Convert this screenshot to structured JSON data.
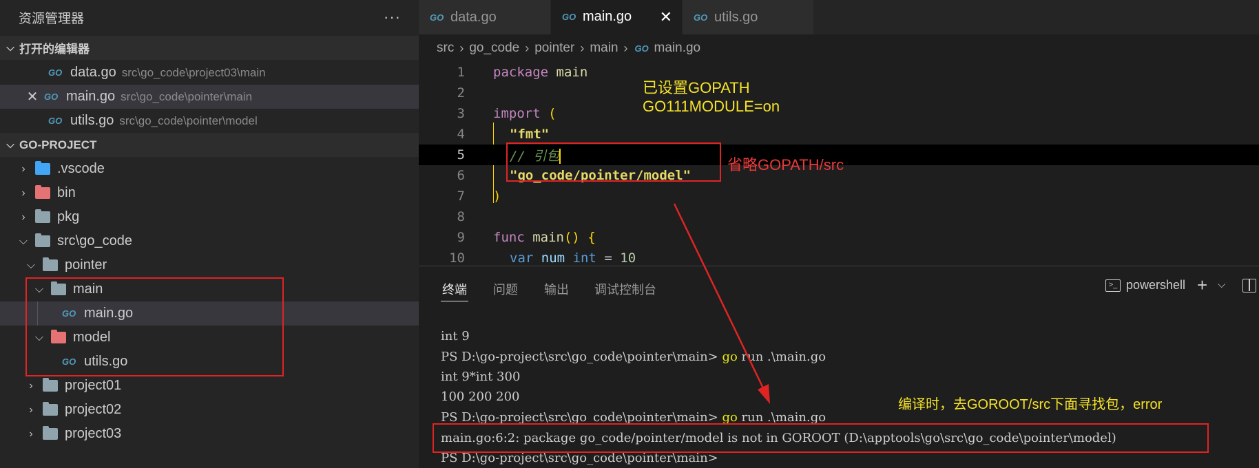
{
  "sidebar": {
    "title": "资源管理器",
    "more": "···",
    "open_editors": {
      "header": "打开的编辑器",
      "items": [
        {
          "name": "data.go",
          "path": "src\\go_code\\project03\\main"
        },
        {
          "name": "main.go",
          "path": "src\\go_code\\pointer\\main"
        },
        {
          "name": "utils.go",
          "path": "src\\go_code\\pointer\\model"
        }
      ]
    },
    "project": {
      "header": "GO-PROJECT",
      "items": [
        {
          "label": ".vscode"
        },
        {
          "label": "bin"
        },
        {
          "label": "pkg"
        },
        {
          "label": "src\\go_code"
        },
        {
          "label": "pointer"
        },
        {
          "label": "main"
        },
        {
          "label": "main.go"
        },
        {
          "label": "model"
        },
        {
          "label": "utils.go"
        },
        {
          "label": "project01"
        },
        {
          "label": "project02"
        },
        {
          "label": "project03"
        }
      ]
    }
  },
  "tabs": [
    {
      "label": "data.go"
    },
    {
      "label": "main.go"
    },
    {
      "label": "utils.go"
    }
  ],
  "tab_close": "✕",
  "go_icon": "GO",
  "breadcrumb": [
    "src",
    "go_code",
    "pointer",
    "main",
    "main.go"
  ],
  "editor": {
    "line_numbers": [
      "1",
      "2",
      "3",
      "4",
      "5",
      "6",
      "7",
      "8",
      "9",
      "10"
    ],
    "tokens": {
      "package": "package",
      "main": "main",
      "import": "import",
      "lparen": "(",
      "fmt": "\"fmt\"",
      "comment": "// 引包",
      "model_path": "\"go_code/pointer/model\"",
      "rparen": ")",
      "func": "func",
      "fmain": "main",
      "fparen": "()",
      "fbrace": "{",
      "var": "var",
      "num": "num",
      "int": "int",
      "eq": "=",
      "ten": "10"
    }
  },
  "annotations": {
    "gopath_set": "已设置GOPATH",
    "module_on": "GO111MODULE=on",
    "omit_src": "省略GOPATH/src",
    "compile_note": "编译时，去GOROOT/src下面寻找包，error"
  },
  "panel": {
    "tabs": [
      "终端",
      "问题",
      "输出",
      "调试控制台"
    ],
    "shell": "powershell",
    "add": "+",
    "chevron": "⌵",
    "terminal": {
      "l1": "int 9",
      "prompt": "PS D:\\go-project\\src\\go_code\\pointer\\main> ",
      "go": "go",
      "run": " run .\\main.go",
      "l3": "int 9*int 300",
      "l4": "100 200 200",
      "l6": "main.go:6:2: package go_code/pointer/model is not in GOROOT (D:\\apptools\\go\\src\\go_code\\pointer\\model)",
      "l7": "PS D:\\go-project\\src\\go_code\\pointer\\main>"
    }
  },
  "colors": {
    "annotation_yellow": "#f5e327",
    "annotation_red": "#e83a3a",
    "box_red": "#e02424"
  }
}
